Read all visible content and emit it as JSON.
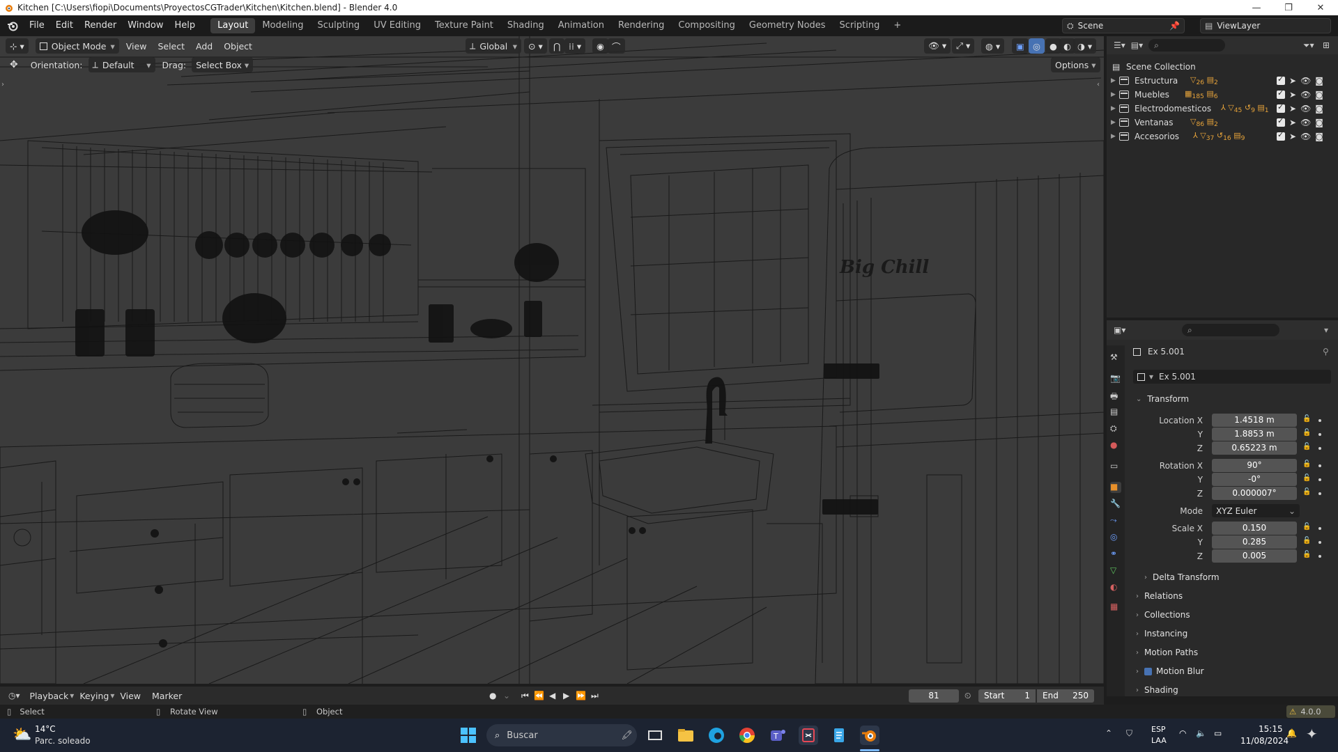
{
  "window": {
    "title": "Kitchen [C:\\Users\\fiopi\\Documents\\ProyectosCGTrader\\Kitchen\\Kitchen.blend] - Blender 4.0",
    "controls": [
      "—",
      "❐",
      "✕"
    ]
  },
  "menu": {
    "items": [
      "File",
      "Edit",
      "Render",
      "Window",
      "Help"
    ]
  },
  "workspaces": {
    "tabs": [
      "Layout",
      "Modeling",
      "Sculpting",
      "UV Editing",
      "Texture Paint",
      "Shading",
      "Animation",
      "Rendering",
      "Compositing",
      "Geometry Nodes",
      "Scripting"
    ],
    "active": "Layout",
    "add": "+"
  },
  "scene": {
    "label": "Scene",
    "view_layer": "ViewLayer"
  },
  "viewport": {
    "mode": "Object Mode",
    "menus": [
      "View",
      "Select",
      "Add",
      "Object"
    ],
    "transform_orientation": "Global",
    "orientation_label": "Orientation:",
    "orientation_value": "Default",
    "drag_label": "Drag:",
    "drag_value": "Select Box",
    "options": "Options",
    "fridge_logo": "Big Chill",
    "shading": "wireframe"
  },
  "outliner": {
    "root": "Scene Collection",
    "collections": [
      {
        "name": "Estructura",
        "counts": [
          "26",
          "2"
        ]
      },
      {
        "name": "Muebles",
        "counts": [
          "185",
          "6"
        ]
      },
      {
        "name": "Electrodomesticos",
        "counts": [
          "45",
          "9",
          "1"
        ]
      },
      {
        "name": "Ventanas",
        "counts": [
          "86",
          "2"
        ]
      },
      {
        "name": "Accesorios",
        "counts": [
          "37",
          "16",
          "9"
        ]
      }
    ]
  },
  "properties": {
    "object_name": "Ex 5.001",
    "data_name": "Ex 5.001",
    "transform_title": "Transform",
    "location": {
      "label": "Location X",
      "x": "1.4518 m",
      "y": "1.8853 m",
      "z": "0.65223 m"
    },
    "rotation": {
      "label": "Rotation X",
      "x": "90°",
      "y": "-0°",
      "z": "0.000007°"
    },
    "mode_label": "Mode",
    "mode_value": "XYZ Euler",
    "scale": {
      "label": "Scale X",
      "x": "0.150",
      "y": "0.285",
      "z": "0.005"
    },
    "axis_y": "Y",
    "axis_z": "Z",
    "sections": [
      "Delta Transform",
      "Relations",
      "Collections",
      "Instancing",
      "Motion Paths",
      "Motion Blur",
      "Shading"
    ]
  },
  "timeline": {
    "menus": [
      "Playback",
      "Keying",
      "View",
      "Marker"
    ],
    "current_frame": "81",
    "start_label": "Start",
    "start": "1",
    "end_label": "End",
    "end": "250"
  },
  "statusbar": {
    "select": "Select",
    "rotate": "Rotate View",
    "object": "Object",
    "version": "4.0.0"
  },
  "taskbar": {
    "weather_temp": "14°C",
    "weather_desc": "Parc. soleado",
    "search": "Buscar",
    "lang_top": "ESP",
    "lang_bottom": "LAA",
    "time": "15:15",
    "date": "11/08/2024"
  },
  "colors": {
    "accent_blue": "#4772b3",
    "viewport_bg": "#3b3b3b",
    "wire": "#121212",
    "orange": "#e87d0d"
  }
}
